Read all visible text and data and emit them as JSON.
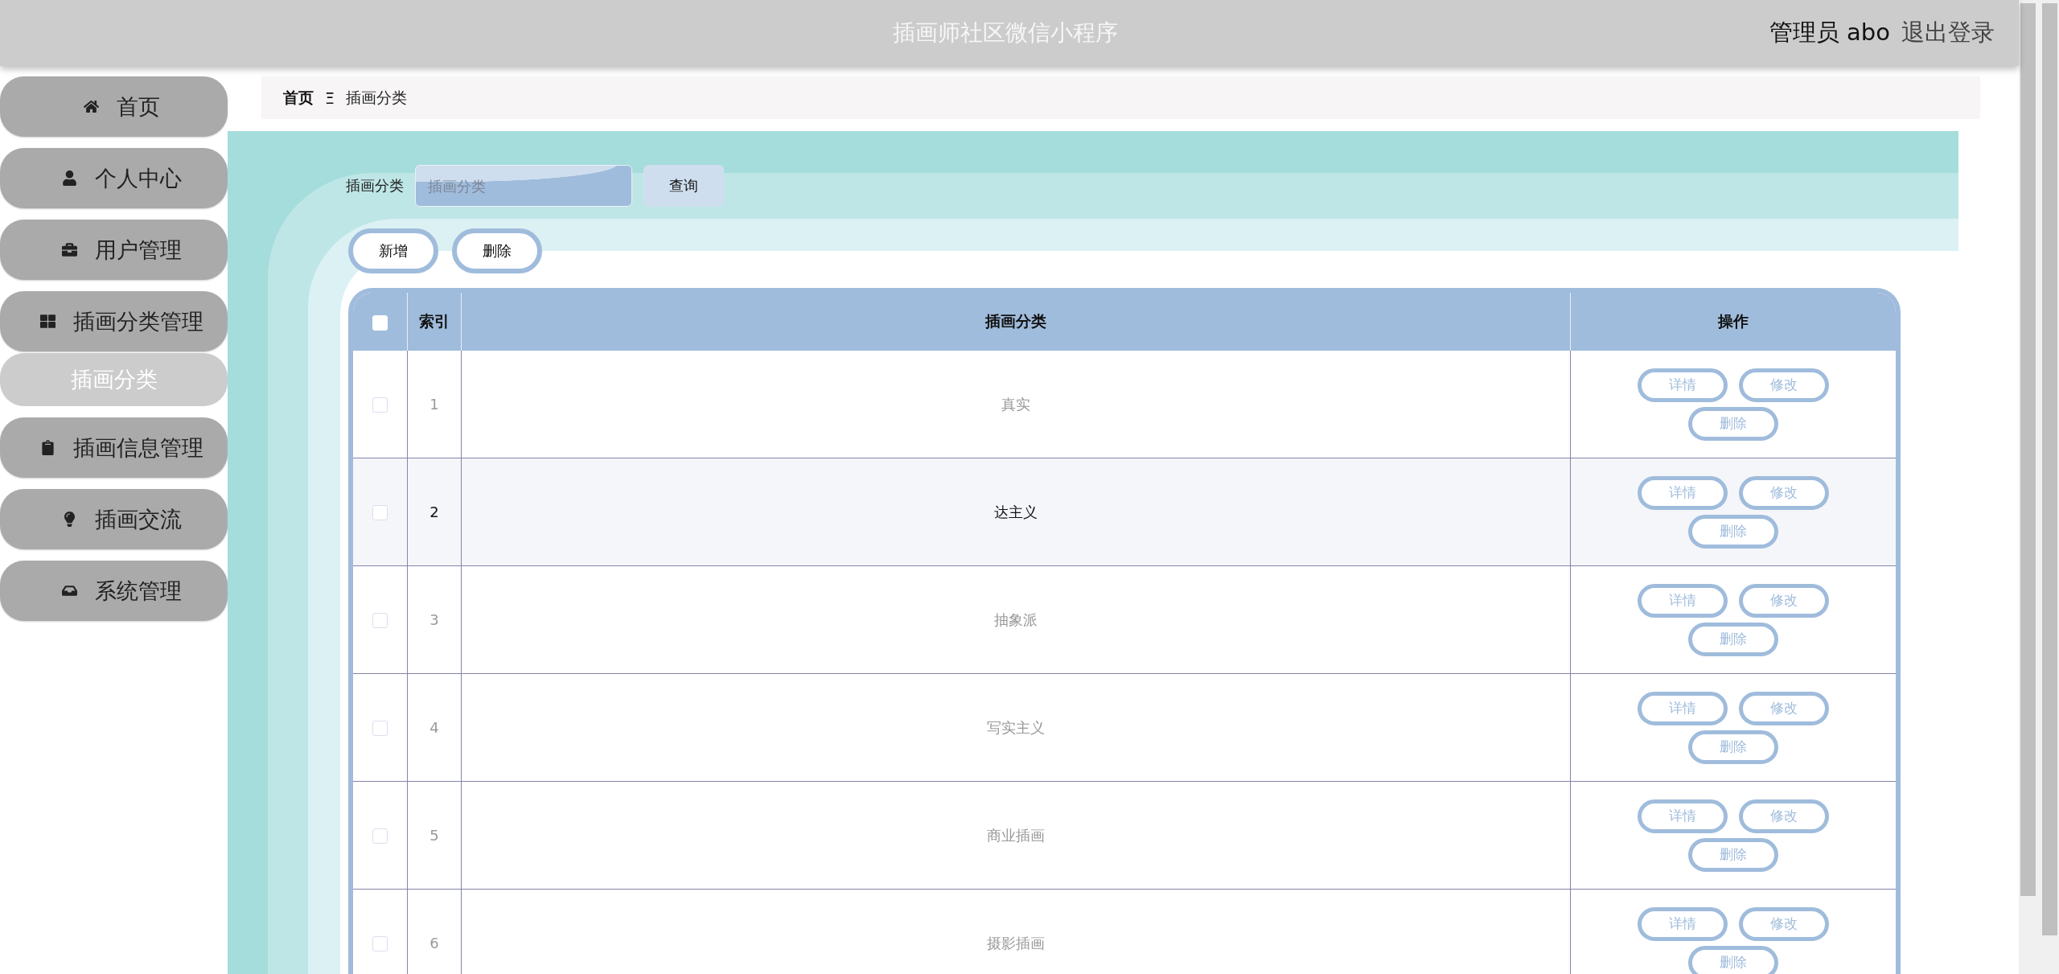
{
  "header": {
    "title": "插画师社区微信小程序",
    "user": "管理员 abo",
    "logout": "退出登录"
  },
  "sidebar": {
    "items": [
      {
        "label": "首页"
      },
      {
        "label": "个人中心"
      },
      {
        "label": "用户管理"
      },
      {
        "label": "插画分类管理",
        "children": [
          {
            "label": "插画分类",
            "selected": true
          }
        ]
      },
      {
        "label": "插画信息管理"
      },
      {
        "label": "插画交流"
      },
      {
        "label": "系统管理"
      }
    ]
  },
  "breadcrumb": {
    "home": "首页",
    "separator": "Ξ",
    "current": "插画分类"
  },
  "search": {
    "label": "插画分类",
    "placeholder": "插画分类",
    "button": "查询"
  },
  "actions": [
    "新增",
    "删除"
  ],
  "table": {
    "header_checked": false,
    "columns": [
      "索引",
      "插画分类",
      "操作"
    ],
    "rows": [
      {
        "index": "1",
        "category": "真实",
        "checked": false,
        "highlighted": false,
        "buttons": [
          "详情",
          "修改",
          "删除"
        ]
      },
      {
        "index": "2",
        "category": "达主义",
        "checked": false,
        "highlighted": true,
        "buttons": [
          "详情",
          "修改",
          "删除"
        ]
      },
      {
        "index": "3",
        "category": "抽象派",
        "checked": false,
        "highlighted": false,
        "buttons": [
          "详情",
          "修改",
          "删除"
        ]
      },
      {
        "index": "4",
        "category": "写实主义",
        "checked": false,
        "highlighted": false,
        "buttons": [
          "详情",
          "修改",
          "删除"
        ]
      },
      {
        "index": "5",
        "category": "商业插画",
        "checked": false,
        "highlighted": false,
        "buttons": [
          "详情",
          "修改",
          "删除"
        ]
      },
      {
        "index": "6",
        "category": "摄影插画",
        "checked": false,
        "highlighted": false,
        "buttons": [
          "详情",
          "修改",
          "删除"
        ]
      }
    ]
  }
}
